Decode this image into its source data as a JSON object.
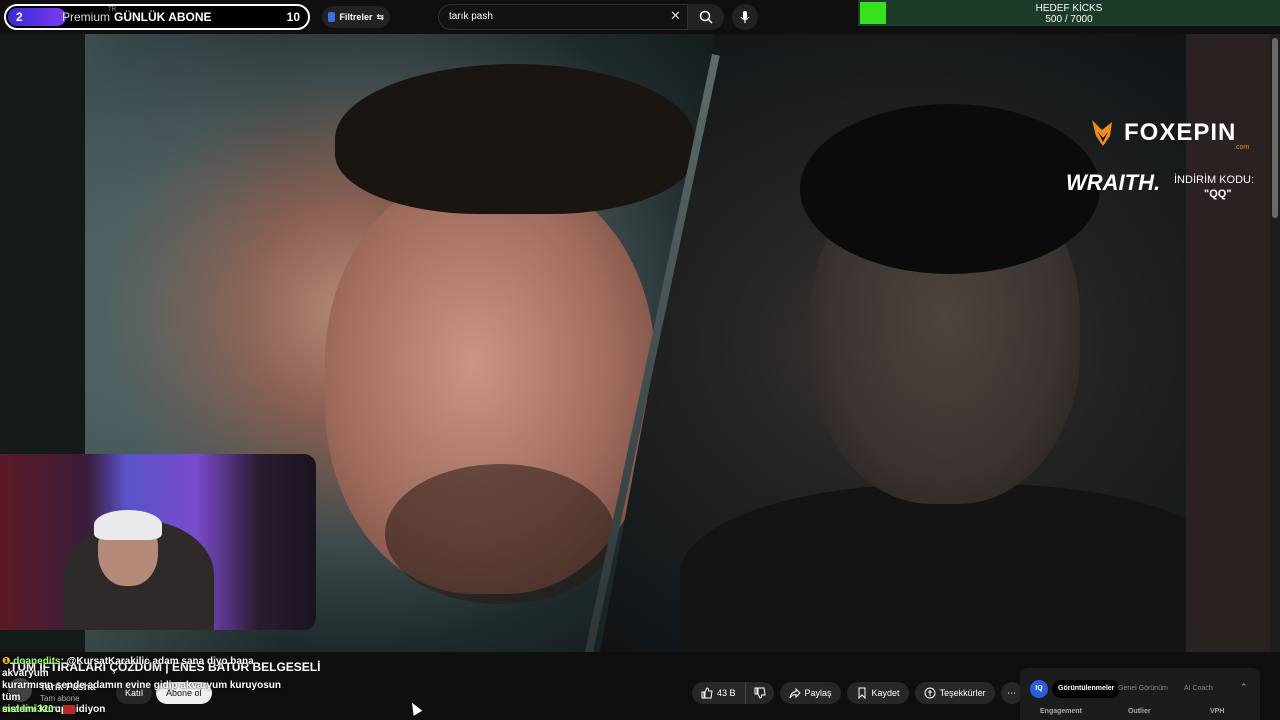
{
  "subscriber_goal": {
    "current": "2",
    "brand": "Premium",
    "tm": "TR",
    "label": "GÜNLÜK ABONE",
    "target": "10"
  },
  "filters": {
    "label": "Filtreler"
  },
  "search": {
    "value": "tarık pash"
  },
  "kick_goal": {
    "title": "HEDEF KİCKS",
    "count": "500 / 7000",
    "progress": 0.071,
    "color": "#36e21c"
  },
  "sponsor": {
    "brand": "FOXEPIN",
    "domain": ".com",
    "brand_color": "#f08c1e",
    "product": "WRAITH.",
    "code_label": "İNDİRİM KODU:",
    "code": "\"QQ\""
  },
  "video": {
    "title": "TÜM İFTİRALARI ÇÖZDÜM | ENES BATUR BELGESELİ",
    "channel": "Tarık Pasha",
    "subs": "Tam abone",
    "join_label": "Katıl",
    "subscribe_label": "Abone ol"
  },
  "chat": {
    "lines": [
      {
        "user": "doanedits",
        "text": ": @KursatKarakilic adam sana diyo bana akvaryum"
      },
      {
        "user": "",
        "text": "kurarmısın sende adamın evine gidip akvaryum kuruyosun tüm"
      },
      {
        "user": "",
        "text": "sistemi kurup gidiyon"
      }
    ],
    "last_user": "maldini320",
    "last_sep": ":"
  },
  "actions": {
    "likes": "43 B",
    "share": "Paylaş",
    "save": "Kaydet",
    "thanks": "Teşekkürler"
  },
  "analytics": {
    "logo": "IQ",
    "tabs": [
      "Görüntülenmeler",
      "Genel Görünüm",
      "AI Coach"
    ],
    "columns": [
      "Engagement",
      "Outlier",
      "VPH"
    ]
  }
}
